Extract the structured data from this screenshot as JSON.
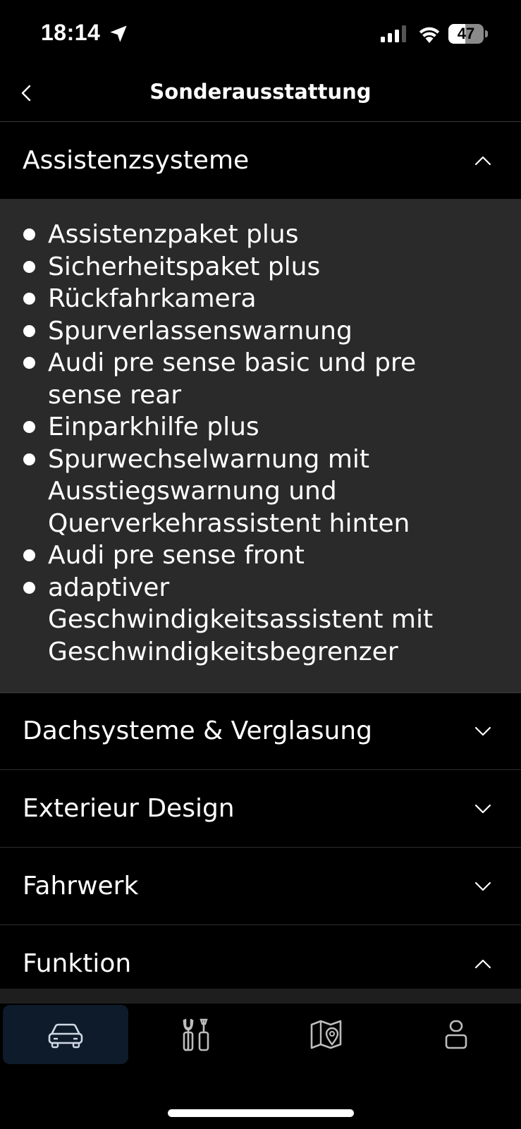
{
  "status_bar": {
    "time": "18:14",
    "battery_level": "47",
    "battery_fraction": 0.47,
    "icons": [
      "location-arrow-icon",
      "signal-icon",
      "wifi-icon",
      "battery-icon"
    ]
  },
  "header": {
    "title": "Sonderausstattung",
    "back_icon": "chevron-left-icon"
  },
  "sections": [
    {
      "label": "Assistenzsysteme",
      "expanded": true,
      "items": [
        "Assistenzpaket plus",
        "Sicherheitspaket plus",
        "Rückfahrkamera",
        "Spurverlassenswarnung",
        "Audi pre sense basic und pre sense rear",
        "Einparkhilfe plus",
        "Spurwechselwarnung mit Ausstiegswarnung und Querverkehrassistent hinten",
        "Audi pre sense front",
        "adaptiver Geschwindigkeitsassistent mit Geschwindigkeitsbegrenzer"
      ]
    },
    {
      "label": "Dachsysteme & Verglasung",
      "expanded": false
    },
    {
      "label": "Exterieur Design",
      "expanded": false
    },
    {
      "label": "Fahrwerk",
      "expanded": false
    },
    {
      "label": "Funktion",
      "expanded": true
    }
  ],
  "bottom_nav": {
    "items": [
      {
        "icon": "car-icon",
        "active": true
      },
      {
        "icon": "service-tools-icon",
        "active": false
      },
      {
        "icon": "map-icon",
        "active": false
      },
      {
        "icon": "profile-icon",
        "active": false
      }
    ]
  },
  "colors": {
    "background": "#000000",
    "expanded_body": "#2a2a2a",
    "active_nav": "#0d1b2a",
    "text": "#ffffff"
  }
}
